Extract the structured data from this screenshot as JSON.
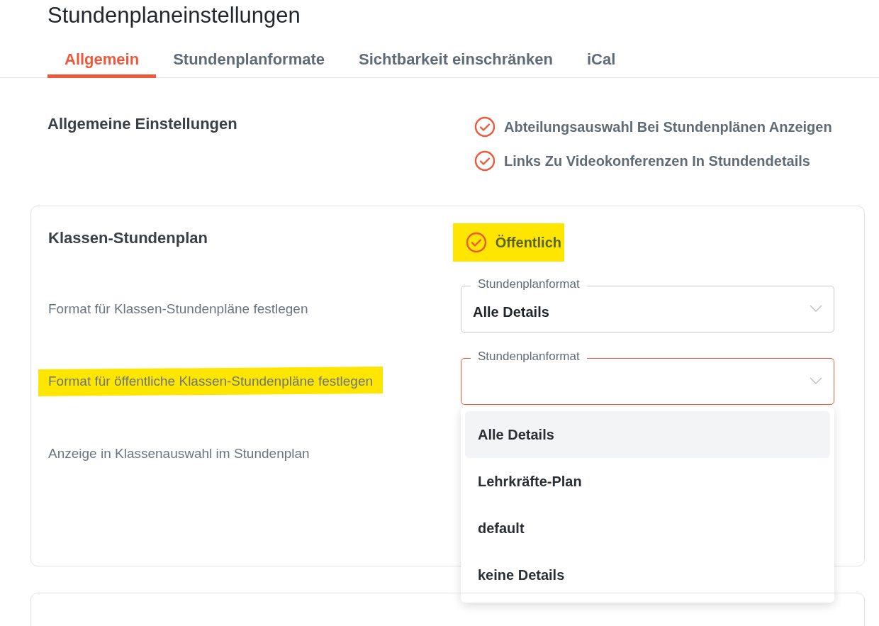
{
  "title": "Stundenplaneinstellungen",
  "tabs": [
    {
      "label": "Allgemein",
      "selected": true
    },
    {
      "label": "Stundenplanformate",
      "selected": false
    },
    {
      "label": "Sichtbarkeit einschränken",
      "selected": false
    },
    {
      "label": "iCal",
      "selected": false
    }
  ],
  "general": {
    "heading": "Allgemeine Einstellungen",
    "options": [
      {
        "label": "Abteilungsauswahl Bei Stundenplänen Anzeigen",
        "checked": true
      },
      {
        "label": "Links Zu Videokonferenzen In Stundendetails",
        "checked": true
      }
    ]
  },
  "class_card": {
    "heading": "Klassen-Stundenplan",
    "public_option": {
      "label": "Öffentlich",
      "checked": true,
      "highlighted": true
    },
    "rows": [
      {
        "label": "Format für Klassen-Stundenpläne festlegen",
        "highlighted": false,
        "field": {
          "label": "Stundenplanformat",
          "value": "Alle Details",
          "focused": false
        }
      },
      {
        "label": "Format für öffentliche Klassen-Stundenpläne festlegen",
        "highlighted": true,
        "field": {
          "label": "Stundenplanformat",
          "focused": true
        }
      },
      {
        "label": "Anzeige in Klassenauswahl im Stundenplan",
        "highlighted": false
      }
    ]
  },
  "dropdown": {
    "options": [
      {
        "label": "Alle Details",
        "selected": true
      },
      {
        "label": "Lehrkräfte-Plan",
        "selected": false
      },
      {
        "label": "default",
        "selected": false
      },
      {
        "label": "keine Details",
        "selected": false
      }
    ]
  }
}
